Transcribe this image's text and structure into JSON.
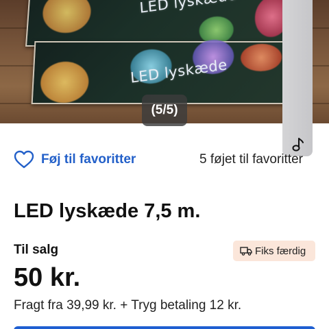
{
  "gallery": {
    "image_text_1": "LED lyskæde",
    "image_text_2": "LED lyskæde",
    "counter": "(5/5)"
  },
  "favorites": {
    "button_label": "Føj til favoritter",
    "count_text": "5 føjet til favoritter"
  },
  "listing": {
    "title": "LED lyskæde 7,5 m.",
    "status": "Til salg",
    "badge": "Fiks færdig",
    "price": "50 kr.",
    "shipping": "Fragt fra 39,99 kr. + Tryg betaling 12 kr."
  },
  "colors": {
    "accent": "#2360c9",
    "badge_bg": "#fbe6da",
    "cta": "#1f5fd1"
  },
  "icons": {
    "favorite": "heart-icon",
    "shipping_badge": "truck-icon",
    "overlay": "music-note-icon"
  }
}
